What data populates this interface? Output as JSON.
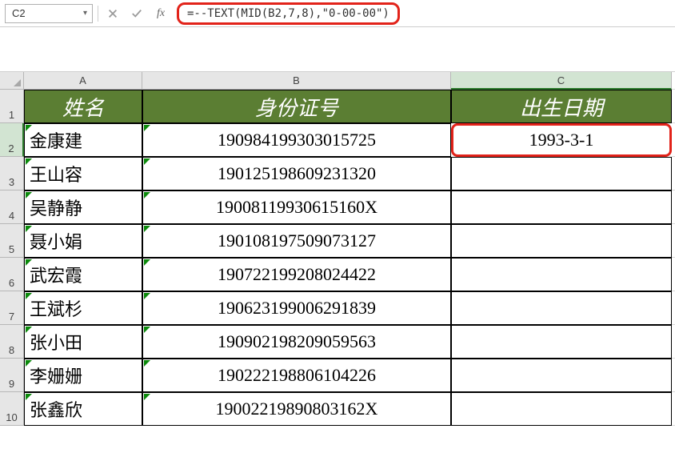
{
  "formula_bar": {
    "name_box": "C2",
    "formula": "=--TEXT(MID(B2,7,8),\"0-00-00\")"
  },
  "columns": [
    "A",
    "B",
    "C"
  ],
  "headers": {
    "A": "姓名",
    "B": "身份证号",
    "C": "出生日期"
  },
  "rows": [
    {
      "num": "1"
    },
    {
      "num": "2",
      "name": "金康建",
      "id": "190984199303015725",
      "date": "1993-3-1"
    },
    {
      "num": "3",
      "name": "王山容",
      "id": "190125198609231320",
      "date": ""
    },
    {
      "num": "4",
      "name": "吴静静",
      "id": "19008119930615160X",
      "date": ""
    },
    {
      "num": "5",
      "name": "聂小娟",
      "id": "190108197509073127",
      "date": ""
    },
    {
      "num": "6",
      "name": "武宏霞",
      "id": "190722199208024422",
      "date": ""
    },
    {
      "num": "7",
      "name": "王斌杉",
      "id": "190623199006291839",
      "date": ""
    },
    {
      "num": "8",
      "name": "张小田",
      "id": "190902198209059563",
      "date": ""
    },
    {
      "num": "9",
      "name": "李姗姗",
      "id": "190222198806104226",
      "date": ""
    },
    {
      "num": "10",
      "name": "张鑫欣",
      "id": "19002219890803162X",
      "date": ""
    }
  ],
  "selected": {
    "row": 2,
    "col": "C"
  }
}
